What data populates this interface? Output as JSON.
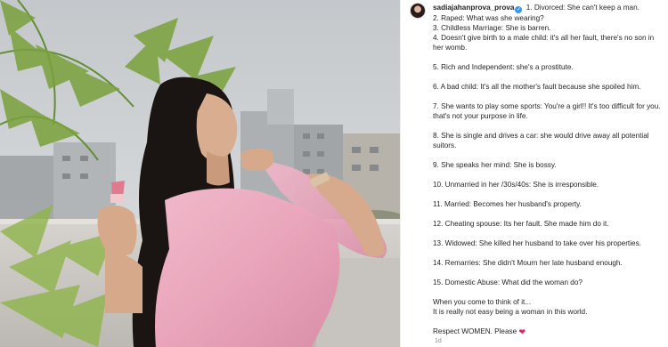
{
  "post": {
    "username": "sadiajahanprova_prova",
    "verified_icon": "verified-badge-icon",
    "timestamp": "1d",
    "caption_lines": [
      "1. Divorced: She can't keep a man.",
      "2. Raped: What was she wearing?",
      "3. Childless Marriage: She is barren.",
      "4. Doesn't give birth to a male child: it's all her fault, there's no son in her womb.",
      "5. Rich and Independent: she's a prostitute.",
      "6. A bad child: It's all the mother's fault because she spoiled him.",
      "7. She wants to play some sports: You're a girl!! It's too difficult for you. that's not your purpose in life.",
      "8. She is single and drives a car: she would drive away all potential suitors.",
      "9. She speaks her mind: She is bossy.",
      "10. Unmarried in her /30s/40s: She is irresponsible.",
      "11. Married: Becomes her husband's property.",
      "12. Cheating spouse: Its her fault. She made him do it.",
      "13. Widowed: She killed her husband to take over his properties.",
      "14. Remarries: She didn't Mourn her late husband enough.",
      "15. Domestic Abuse: What did the woman do?",
      "When you come to think of it...",
      "It is really not easy being a woman in this world.",
      "Respect WOMEN. Please"
    ],
    "closing_emoji": "❤",
    "closing_emoji_icon": "red-heart-icon"
  },
  "colors": {
    "heart": "#e0245e",
    "verified": "#3897f0",
    "saree": "#e9a7bd"
  }
}
